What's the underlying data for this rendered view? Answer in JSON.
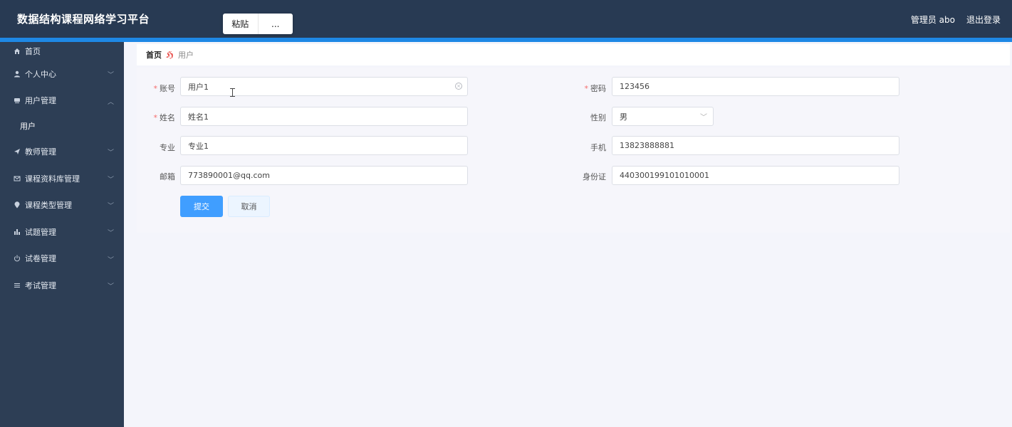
{
  "header": {
    "title": "数据结构课程网络学习平台",
    "user": "管理员 abo",
    "logout": "退出登录"
  },
  "context_menu": {
    "paste": "粘贴",
    "more": "..."
  },
  "sidebar": {
    "items": [
      {
        "label": "首页",
        "icon": "home-icon"
      },
      {
        "label": "个人中心",
        "icon": "user-icon"
      },
      {
        "label": "用户管理",
        "icon": "drive-icon",
        "expanded": true
      },
      {
        "label": "用户"
      },
      {
        "label": "教师管理",
        "icon": "send-icon"
      },
      {
        "label": "课程资料库管理",
        "icon": "mail-icon"
      },
      {
        "label": "课程类型管理",
        "icon": "location-icon"
      },
      {
        "label": "试题管理",
        "icon": "bar-chart-icon"
      },
      {
        "label": "试卷管理",
        "icon": "power-icon"
      },
      {
        "label": "考试管理",
        "icon": "menu-icon"
      }
    ]
  },
  "breadcrumb": {
    "home": "首页",
    "current": "用户"
  },
  "form": {
    "account": {
      "label": "账号",
      "value": "用户1"
    },
    "password": {
      "label": "密码",
      "value": "123456"
    },
    "name": {
      "label": "姓名",
      "value": "姓名1"
    },
    "gender": {
      "label": "性别",
      "value": "男"
    },
    "major": {
      "label": "专业",
      "value": "专业1"
    },
    "phone": {
      "label": "手机",
      "value": "13823888881"
    },
    "email": {
      "label": "邮箱",
      "value": "773890001@qq.com"
    },
    "idcard": {
      "label": "身份证",
      "value": "440300199101010001"
    },
    "submit": "提交",
    "cancel": "取消"
  },
  "colors": {
    "topbar": "#283a53",
    "sidebar": "#2d3e55",
    "accent": "#1e88e5",
    "primary": "#409eff",
    "required": "#f56c6c"
  }
}
